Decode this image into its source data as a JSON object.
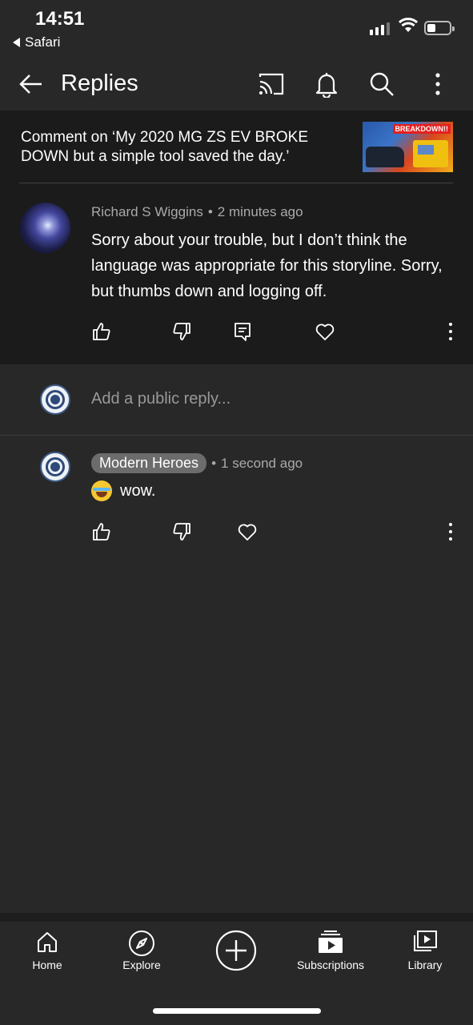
{
  "status_bar": {
    "time": "14:51",
    "back_app": "Safari",
    "signal_bars_active": 3,
    "signal_bars_total": 4,
    "battery_level": 0.25
  },
  "header": {
    "title": "Replies",
    "icons": [
      "back-arrow-icon",
      "cast-icon",
      "bell-icon",
      "search-icon",
      "more-vert-icon"
    ]
  },
  "context": {
    "comment_on": "Comment on ‘My 2020 MG ZS EV BROKE DOWN but a simple tool saved the day.’",
    "thumbnail_badge": "BREAKDOWN!!"
  },
  "parent_comment": {
    "author": "Richard S Wiggins",
    "separator": "•",
    "time": "2 minutes ago",
    "text": "Sorry about your trouble, but I don’t think the language was appropriate for this storyline. Sorry, but thumbs down and logging off."
  },
  "reply_input": {
    "placeholder": "Add a public reply..."
  },
  "reply": {
    "author": "Modern Heroes",
    "separator": "•",
    "time": "1 second ago",
    "emoji": "😂",
    "text": "wow."
  },
  "tabs": [
    {
      "label": "Home",
      "icon": "home-icon"
    },
    {
      "label": "Explore",
      "icon": "compass-icon"
    },
    {
      "label": "",
      "icon": "create-plus-icon"
    },
    {
      "label": "Subscriptions",
      "icon": "subscriptions-icon"
    },
    {
      "label": "Library",
      "icon": "library-icon"
    }
  ],
  "colors": {
    "background": "#282828",
    "panel": "#1b1b1b",
    "secondary_text": "#aaaaaa",
    "author_chip": "#6c6c6c"
  }
}
